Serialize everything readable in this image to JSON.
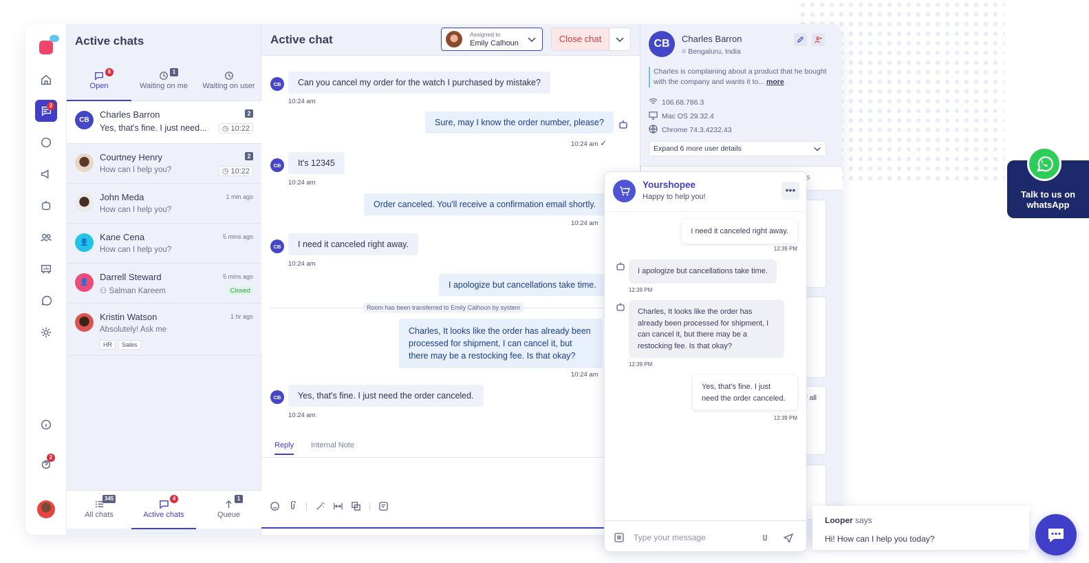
{
  "rail": {
    "chat_badge": "2",
    "support_badge": "2"
  },
  "list": {
    "title": "Active chats",
    "tabs": [
      {
        "label": "Open",
        "badge": "6"
      },
      {
        "label": "Waiting on me",
        "badge": "1"
      },
      {
        "label": "Waiting on user",
        "badge": ""
      }
    ],
    "items": [
      {
        "initials": "CB",
        "name": "Charles Barron",
        "message": "Yes, that's fine. I just need...",
        "count": "2",
        "time": "10:22"
      },
      {
        "name": "Courtney Henry",
        "message": "How can I help you?",
        "count": "2",
        "time": "10:22"
      },
      {
        "name": "John Meda",
        "message": "How can I help you?",
        "time": "1 min ago"
      },
      {
        "name": "Kane Cena",
        "message": "How can I help you?",
        "time": "5 mins ago"
      },
      {
        "name": "Darrell Steward",
        "message": "Salman Kareem",
        "time": "5 mins ago",
        "status": "Closed"
      },
      {
        "name": "Kristin Watson",
        "message": "Absolutely! Ask me",
        "time": "1 hr ago",
        "tags": [
          "HR",
          "Sales"
        ]
      }
    ],
    "bottom_tabs": [
      {
        "label": "All chats",
        "badge": "345"
      },
      {
        "label": "Active chats",
        "badge": "4"
      },
      {
        "label": "Queue",
        "badge": "1"
      }
    ]
  },
  "chat": {
    "title": "Active chat",
    "assigned_label": "Assigned to",
    "assigned_name": "Emily Calhoun",
    "close_label": "Close chat",
    "avatar_initials": "CB",
    "messages": [
      {
        "text": "Can you cancel my order for the watch I purchased by mistake?",
        "time": "10:24 am"
      },
      {
        "text": "Sure, may I know the order number, please?",
        "time": "10:24 am"
      },
      {
        "text": "It's 12345",
        "time": "10:24 am"
      },
      {
        "text": "Order canceled. You'll receive a confirmation email shortly.",
        "time": "10:24 am"
      },
      {
        "text": "I need it canceled right away.",
        "time": "10:24 am"
      },
      {
        "text": "I apologize but cancellations take time."
      },
      {
        "text": "Charles, It looks like the order has already been processed for shipment, I can cancel it, but there may be a restocking fee. Is that okay?",
        "time": "10:24 am"
      },
      {
        "text": "Yes, that's fine. I just need the order canceled.",
        "time": "10:24 am"
      }
    ],
    "system_note": "Room has been transferred to Emily Calhoun by system",
    "reply_tab": "Reply",
    "note_tab": "Internal Note"
  },
  "info": {
    "initials": "CB",
    "name": "Charles Barron",
    "location": "Bengaluru, India",
    "description": "Charles is complaining about a product that he bought with the company and wants it to...",
    "more": "more",
    "ip": "106.68.786.3",
    "os": "Mac OS 29.32.4",
    "browser": "Chrome 74.3.4232.43",
    "expand": "Expand 6 more user details",
    "partial_1": "s",
    "partial_2": "w all"
  },
  "widget": {
    "name": "Yourshopee",
    "subtitle": "Happy to help you!",
    "messages": [
      {
        "text": "I need it canceled right away.",
        "time": "12:39 PM"
      },
      {
        "text": "I apologize but cancellations take time.",
        "time": "12:39 PM"
      },
      {
        "text": "Charles, It looks like the order has already been processed for shipment, I can cancel it, but there may be a restocking fee. Is that okay?",
        "time": "12:39 PM"
      },
      {
        "text": "Yes, that's fine. I just need the order canceled.",
        "time": "12:39 PM"
      }
    ],
    "placeholder": "Type your message"
  },
  "whatsapp": {
    "label": "Talk to us on whatsApp"
  },
  "looper": {
    "name": "Looper",
    "says": "says",
    "message": "Hi! How can I help you today?"
  },
  "colors": {
    "accent": "#3f3fc9",
    "danger": "#d63a3a",
    "whatsapp": "#2ecc58",
    "navy": "#1c2a6b"
  }
}
